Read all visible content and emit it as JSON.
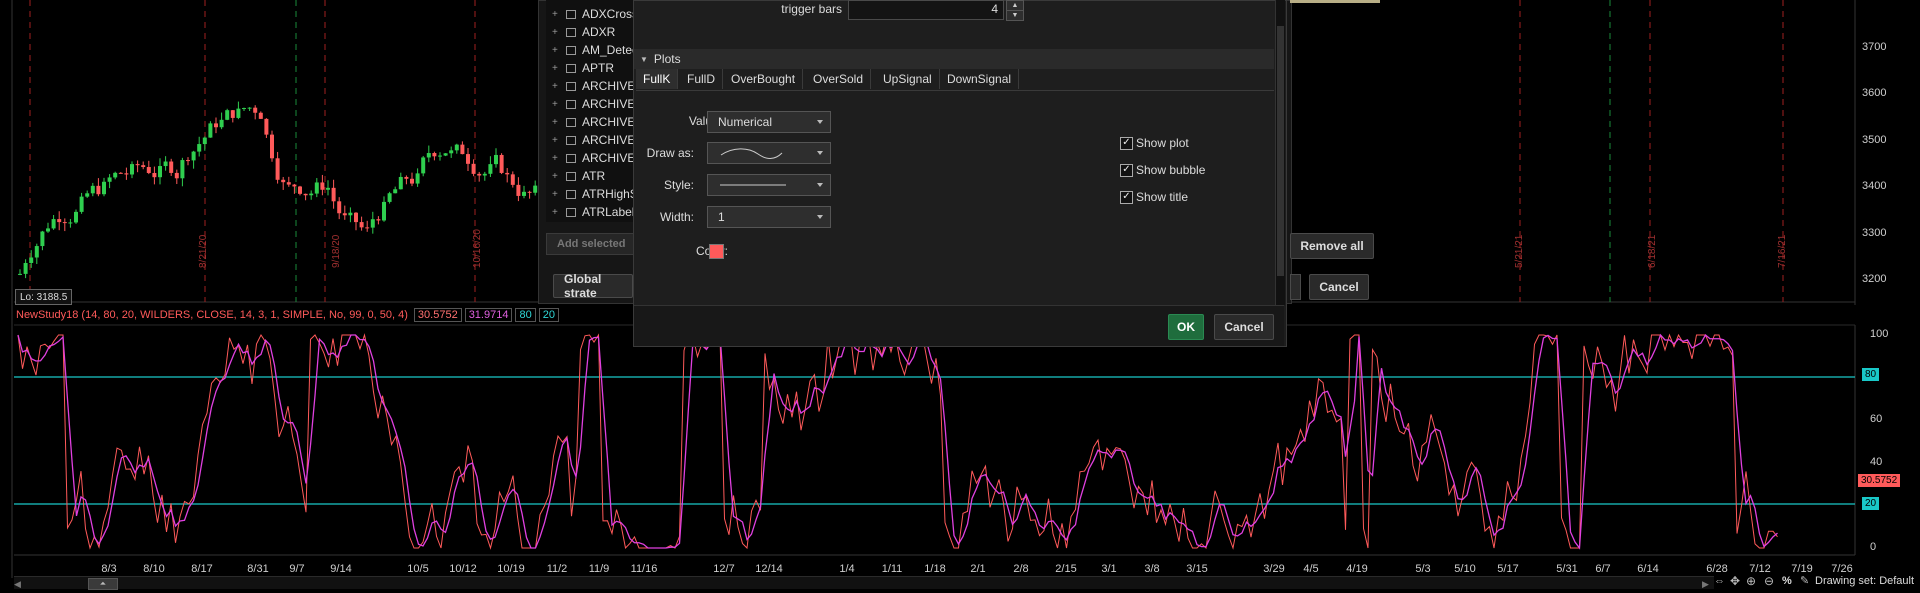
{
  "price_chart": {
    "lo_label": "Lo: 3188.5",
    "price_axis": [
      "3700",
      "3600",
      "3500",
      "3400",
      "3300",
      "3200"
    ],
    "date_marks": [
      "8/21/20",
      "9/18/20",
      "10/16/20",
      "5/21/21",
      "6/18/21",
      "7/16/21"
    ]
  },
  "study": {
    "header": "NewStudy18 (14, 80, 20, WILDERS, CLOSE, 14, 3, 1, SIMPLE, No, 99, 0, 50, 4)",
    "fullk_value": "30.5752",
    "fulld_value": "31.9714",
    "ob_value": "80",
    "os_value": "20",
    "axis": [
      "100",
      "80",
      "60",
      "40",
      "30.5752",
      "20",
      "0"
    ],
    "date_labels": [
      "8/3",
      "8/10",
      "8/17",
      "8/31",
      "9/7",
      "9/14",
      "10/5",
      "10/12",
      "10/19",
      "11/2",
      "11/9",
      "11/16",
      "12/7",
      "12/14",
      "1/4",
      "1/11",
      "1/18",
      "2/1",
      "2/8",
      "2/15",
      "3/1",
      "3/8",
      "3/15",
      "3/29",
      "4/5",
      "4/19",
      "5/3",
      "5/10",
      "5/17",
      "5/31",
      "6/7",
      "6/14",
      "6/28",
      "7/12",
      "7/19",
      "7/26"
    ],
    "colors": {
      "fullk": "#ff5a5a",
      "fulld": "#e040e0",
      "levels": "#19c8c8"
    }
  },
  "strategy_list": {
    "items": [
      "ADXCross",
      "ADXR",
      "AM_Detec",
      "APTR",
      "ARCHIVE_",
      "ARCHIVE_",
      "ARCHIVE_",
      "ARCHIVE_",
      "ARCHIVE_",
      "ATR",
      "ATRHighS",
      "ATRLabels"
    ],
    "add_selected": "Add selected",
    "global_strategy": "Global strate",
    "remove_all": "Remove all",
    "cancel": "Cancel"
  },
  "dialog": {
    "trigger_bars_label": "trigger bars",
    "trigger_bars_value": "4",
    "plots_header": "Plots",
    "tabs": [
      "FullK",
      "FullD",
      "OverBought",
      "OverSold",
      "UpSignal",
      "DownSignal"
    ],
    "values_label": "Values:",
    "values_value": "Numerical",
    "draw_as_label": "Draw as:",
    "style_label": "Style:",
    "width_label": "Width:",
    "width_value": "1",
    "color_label": "Color:",
    "plot_color": "#ff5a5a",
    "show_plot": "Show plot",
    "show_bubble": "Show bubble",
    "show_title": "Show title",
    "ok": "OK",
    "cancel": "Cancel"
  },
  "bottom_bar": {
    "percent": "%",
    "drawing_set": "Drawing set: Default"
  }
}
